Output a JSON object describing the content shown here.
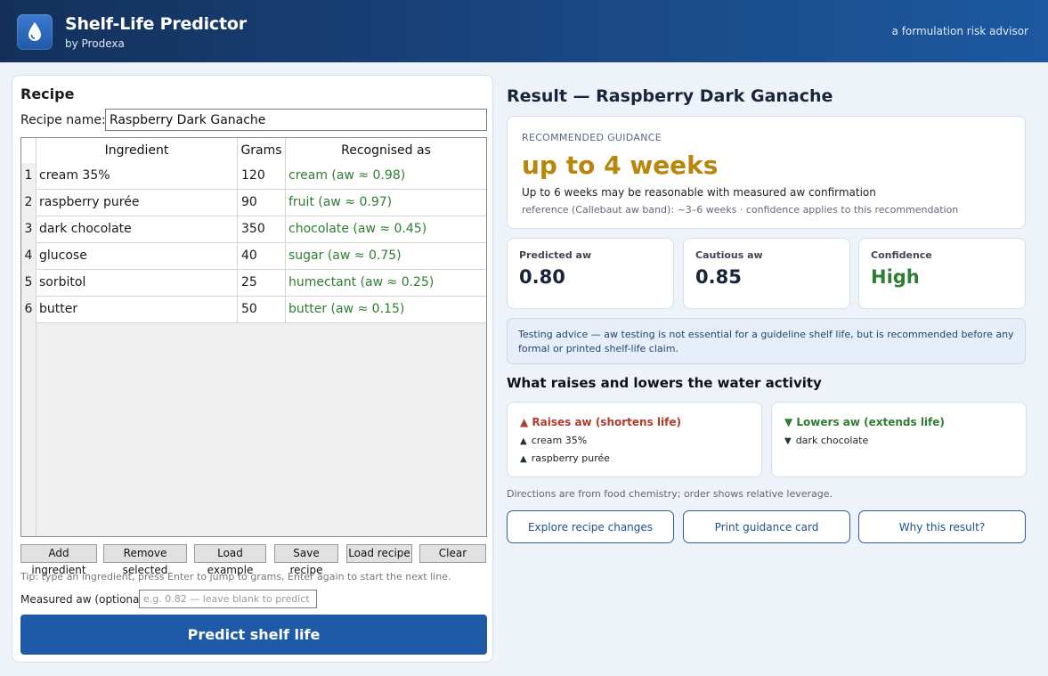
{
  "header": {
    "title": "Shelf-Life Predictor",
    "subtitle": "by Prodexa",
    "tagline": "a formulation risk advisor"
  },
  "recipe": {
    "heading": "Recipe",
    "name_label": "Recipe name:",
    "name_value": "Raspberry Dark Ganache",
    "columns": [
      "Ingredient",
      "Grams",
      "Recognised as"
    ],
    "rows": [
      {
        "n": "1",
        "ingredient": "cream 35%",
        "grams": "120",
        "recognised": "cream  (aw ≈ 0.98)"
      },
      {
        "n": "2",
        "ingredient": "raspberry purée",
        "grams": "90",
        "recognised": "fruit  (aw ≈ 0.97)"
      },
      {
        "n": "3",
        "ingredient": "dark chocolate",
        "grams": "350",
        "recognised": "chocolate  (aw ≈ 0.45)"
      },
      {
        "n": "4",
        "ingredient": "glucose",
        "grams": "40",
        "recognised": "sugar  (aw ≈ 0.75)"
      },
      {
        "n": "5",
        "ingredient": "sorbitol",
        "grams": "25",
        "recognised": "humectant  (aw ≈ 0.25)"
      },
      {
        "n": "6",
        "ingredient": "butter",
        "grams": "50",
        "recognised": "butter  (aw ≈ 0.15)"
      }
    ],
    "buttons": {
      "add": "Add ingredient",
      "remove": "Remove selected",
      "load_example": "Load example",
      "save": "Save recipe",
      "load": "Load recipe",
      "clear": "Clear"
    },
    "tip": "Tip: type an ingredient, press Enter to jump to grams, Enter again to start the next line.",
    "measured_label": "Measured aw (optional):",
    "measured_placeholder": "e.g. 0.82 — leave blank to predict",
    "predict_label": "Predict shelf life"
  },
  "result": {
    "heading": "Result — Raspberry Dark Ganache",
    "guidance_label": "RECOMMENDED GUIDANCE",
    "guidance_main": "up to 4 weeks",
    "guidance_line": "Up to 6 weeks may be reasonable with measured aw confirmation",
    "guidance_ref": "reference (Callebaut aw band): ~3–6 weeks  ·  confidence applies to this recommendation",
    "metrics": [
      {
        "label": "Predicted aw",
        "value": "0.80"
      },
      {
        "label": "Cautious aw",
        "value": "0.85"
      },
      {
        "label": "Confidence",
        "value": "High"
      }
    ],
    "advice": "Testing advice — aw testing is not essential for a guideline shelf life, but is recommended before any formal or printed shelf-life claim.",
    "factors_heading": "What raises and lowers the water activity",
    "raises_title": "▲ Raises aw (shortens life)",
    "raises_items": [
      "cream 35%",
      "raspberry purée"
    ],
    "lowers_title": "▼ Lowers aw (extends life)",
    "lowers_items": [
      "dark chocolate"
    ],
    "directions_note": "Directions are from food chemistry; order shows relative leverage.",
    "actions": {
      "explore": "Explore recipe changes",
      "print": "Print guidance card",
      "why": "Why this result?"
    }
  },
  "colors": {
    "header_accent": "#1a4a86",
    "primary_button": "#1e5aa8",
    "guidance_amber": "#b8860b",
    "confidence_green": "#2e7d32",
    "raises_red": "#b03a2e"
  }
}
